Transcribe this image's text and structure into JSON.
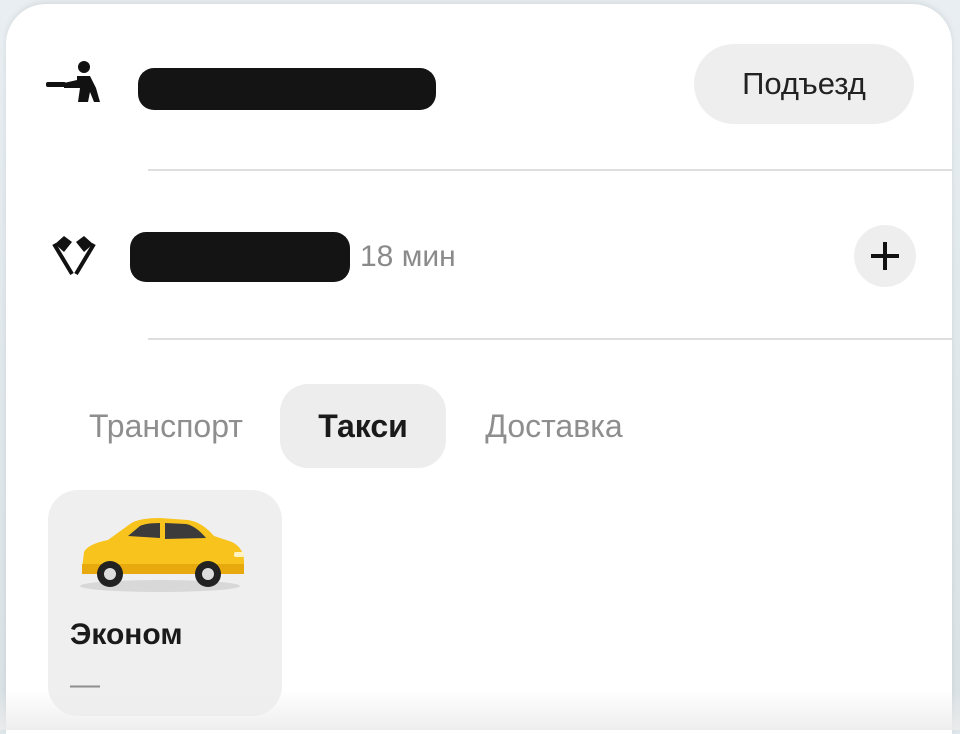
{
  "route": {
    "from": {
      "icon": "person-pickup-icon",
      "entrance_label": "Подъезд"
    },
    "to": {
      "icon": "finish-flags-icon",
      "eta": "18 мин",
      "add_stop_icon": "plus-icon"
    }
  },
  "tabs": [
    {
      "label": "Транспорт",
      "active": false
    },
    {
      "label": "Такси",
      "active": true
    },
    {
      "label": "Доставка",
      "active": false
    }
  ],
  "tariffs": [
    {
      "name": "Эконом",
      "price": "—",
      "icon": "yellow-car-icon",
      "selected": true
    }
  ],
  "colors": {
    "accent_car": "#f7c31c",
    "muted_text": "#8e8e8e",
    "chip_bg": "#eeeeee"
  }
}
